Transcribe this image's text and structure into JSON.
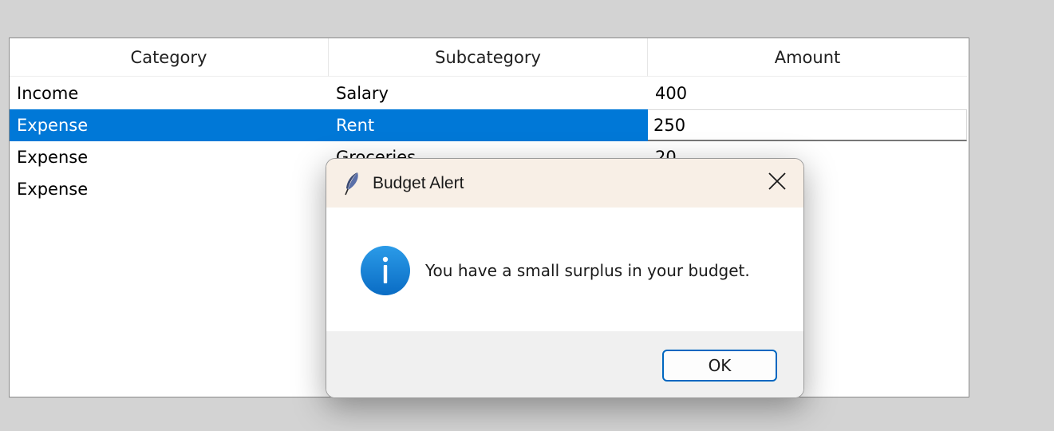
{
  "table": {
    "columns": [
      "Category",
      "Subcategory",
      "Amount"
    ],
    "rows": [
      [
        "Income",
        "Salary",
        "400"
      ],
      [
        "Expense",
        "Rent",
        "250"
      ],
      [
        "Expense",
        "Groceries",
        "20"
      ],
      [
        "Expense",
        "",
        ""
      ]
    ],
    "selected_row": 1,
    "selection_color": "#0078d7"
  },
  "dialog": {
    "title": "Budget Alert",
    "title_icon": "feather-icon",
    "message": "You have a small surplus in your budget.",
    "message_icon": "info-icon",
    "ok_label": "OK",
    "accent": "#0067c0"
  }
}
